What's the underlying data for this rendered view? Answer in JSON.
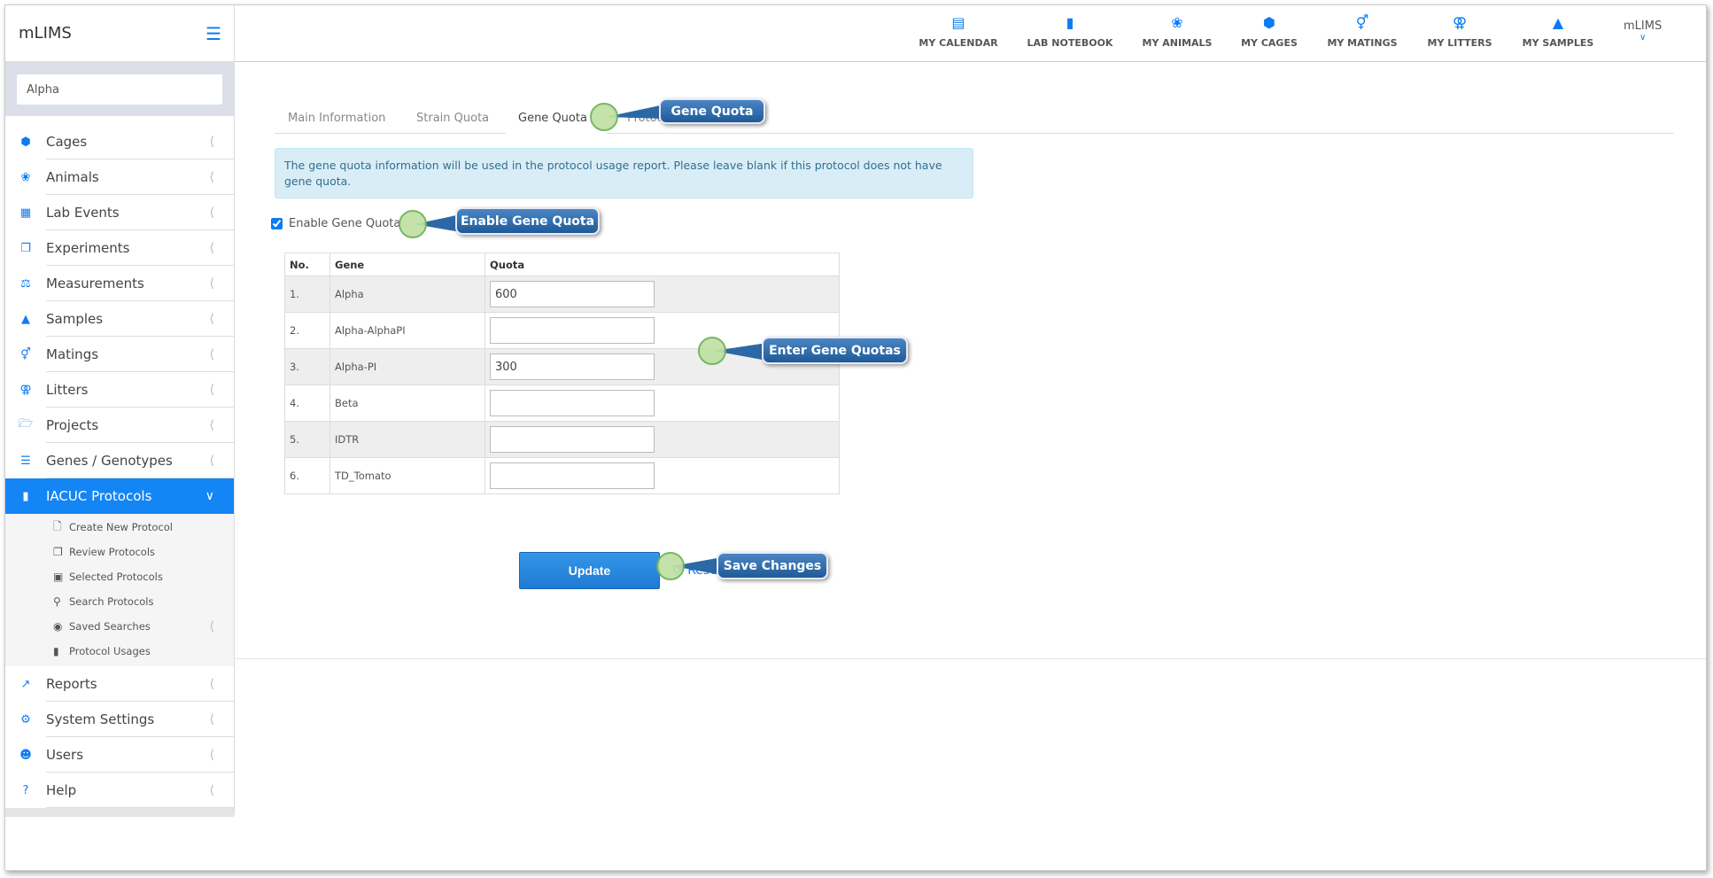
{
  "app": {
    "brand": "mLIMS",
    "user": "mLIMS"
  },
  "search": {
    "value": "Alpha"
  },
  "topnav": [
    {
      "label": "MY CALENDAR",
      "icon": "calendar-icon"
    },
    {
      "label": "LAB NOTEBOOK",
      "icon": "book-icon"
    },
    {
      "label": "MY ANIMALS",
      "icon": "paw-icon"
    },
    {
      "label": "MY CAGES",
      "icon": "cube-icon"
    },
    {
      "label": "MY MATINGS",
      "icon": "mating-icon"
    },
    {
      "label": "MY LITTERS",
      "icon": "litter-icon"
    },
    {
      "label": "MY SAMPLES",
      "icon": "flask-icon"
    }
  ],
  "sidebar": {
    "items": [
      {
        "label": "Cages",
        "icon": "cube-icon"
      },
      {
        "label": "Animals",
        "icon": "paw-icon"
      },
      {
        "label": "Lab Events",
        "icon": "calendar-icon"
      },
      {
        "label": "Experiments",
        "icon": "copy-icon"
      },
      {
        "label": "Measurements",
        "icon": "scale-icon"
      },
      {
        "label": "Samples",
        "icon": "flask-icon"
      },
      {
        "label": "Matings",
        "icon": "mating-icon"
      },
      {
        "label": "Litters",
        "icon": "litter-icon"
      },
      {
        "label": "Projects",
        "icon": "folder-icon"
      },
      {
        "label": "Genes / Genotypes",
        "icon": "list-icon"
      },
      {
        "label": "IACUC Protocols",
        "icon": "book-icon"
      }
    ],
    "sub": [
      {
        "label": "Create New Protocol",
        "icon": "file-icon"
      },
      {
        "label": "Review Protocols",
        "icon": "copy-icon"
      },
      {
        "label": "Selected Protocols",
        "icon": "cart-icon"
      },
      {
        "label": "Search Protocols",
        "icon": "search-icon"
      },
      {
        "label": "Saved Searches",
        "icon": "dot-circle-icon"
      },
      {
        "label": "Protocol Usages",
        "icon": "book-icon"
      }
    ],
    "bottom": [
      {
        "label": "Reports",
        "icon": "chart-icon"
      },
      {
        "label": "System Settings",
        "icon": "gear-icon"
      },
      {
        "label": "Users",
        "icon": "users-icon"
      },
      {
        "label": "Help",
        "icon": "question-icon"
      }
    ]
  },
  "tabs": [
    "Main Information",
    "Strain Quota",
    "Gene Quota",
    "Protocol Level Quota"
  ],
  "alert": "The gene quota information will be used in the protocol usage report. Please leave blank if this protocol does not have gene quota.",
  "enable": {
    "label": "Enable Gene Quota",
    "checked": true
  },
  "table": {
    "headers": [
      "No.",
      "Gene",
      "Quota"
    ],
    "rows": [
      {
        "no": "1.",
        "gene": "Alpha",
        "quota": "600"
      },
      {
        "no": "2.",
        "gene": "Alpha-AlphaPI",
        "quota": ""
      },
      {
        "no": "3.",
        "gene": "Alpha-PI",
        "quota": "300"
      },
      {
        "no": "4.",
        "gene": "Beta",
        "quota": ""
      },
      {
        "no": "5.",
        "gene": "IDTR",
        "quota": ""
      },
      {
        "no": "6.",
        "gene": "TD_Tomato",
        "quota": ""
      }
    ]
  },
  "buttons": {
    "update": "Update",
    "reset": "Reset"
  },
  "callouts": {
    "gene_quota": "Gene Quota",
    "enable": "Enable Gene Quota",
    "enter": "Enter Gene Quotas",
    "save": "Save Changes"
  }
}
